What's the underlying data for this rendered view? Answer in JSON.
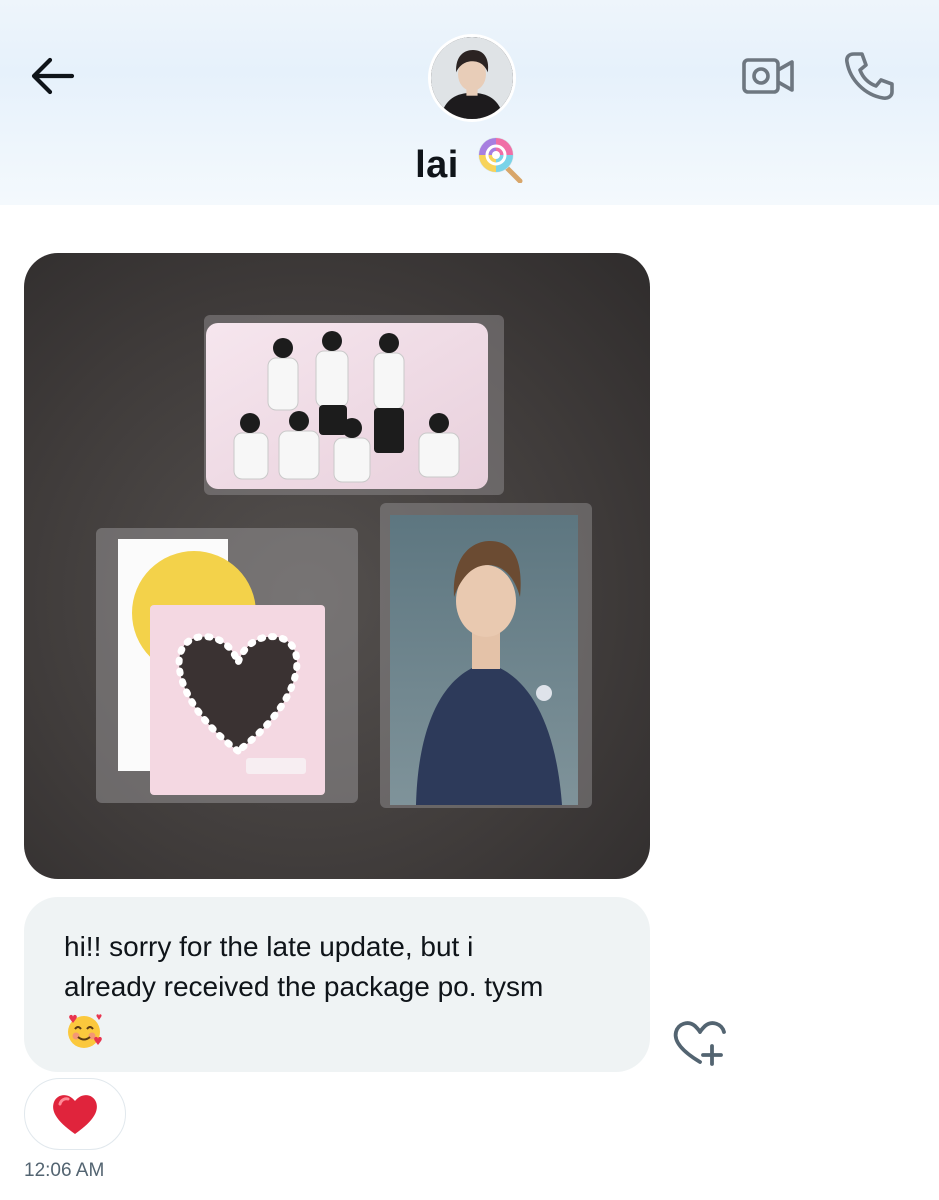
{
  "header": {
    "contact_name": "lai",
    "name_emoji": "lollipop-emoji",
    "back_icon": "arrow-left-icon",
    "video_icon": "video-camera-icon",
    "phone_icon": "phone-icon"
  },
  "message": {
    "text_line1": "hi!! sorry for the late update, but i",
    "text_line2": "already received the package po. tysm",
    "emoji": "smiling-face-with-hearts",
    "timestamp": "12:06 AM",
    "reaction": "red-heart",
    "add_reaction_icon": "heart-plus-icon"
  },
  "colors": {
    "text": "#0f1419",
    "secondary_text": "#536471",
    "bubble": "#eff3f4",
    "icon": "#6e7780"
  }
}
